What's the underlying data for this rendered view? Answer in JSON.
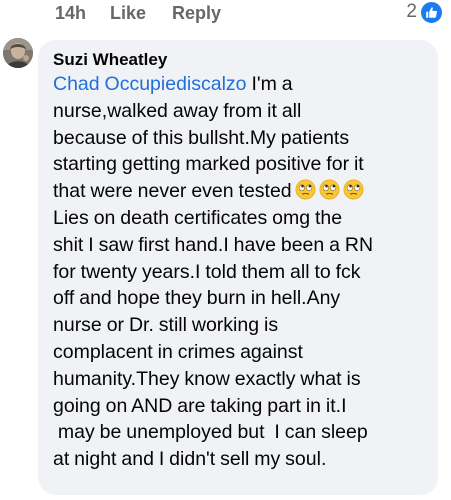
{
  "previous_comment_actions": {
    "time": "14h",
    "like_label": "Like",
    "reply_label": "Reply",
    "reaction_count": "2",
    "reaction_type": "like-icon"
  },
  "comment": {
    "author": "Suzi Wheatley",
    "mention": "Chad Occupiediscalzo",
    "text_part1": " I'm a\nnurse,walked away from it all\nbecause of this bullsht.My patients\nstarting getting marked positive for it\nthat were never even tested",
    "emoji_name": "face-with-rolling-eyes-icon",
    "emoji_count": 3,
    "text_part2": "\nLies on death certificates omg the\nshit I saw first hand.I have been a RN\nfor twenty years.I told them all to fck\noff and hope they burn in hell.Any\nnurse or Dr. still working is\ncomplacent in crimes against\nhumanity.They know exactly what is\ngoing on AND are taking part in it.I\n may be unemployed but  I can sleep\nat night and I didn't sell my soul."
  },
  "colors": {
    "bubble_background": "#f0f2f5",
    "mention": "#216fdb",
    "meta_text": "#65676b",
    "like_badge": "#1b7cf2",
    "text": "#050505"
  }
}
